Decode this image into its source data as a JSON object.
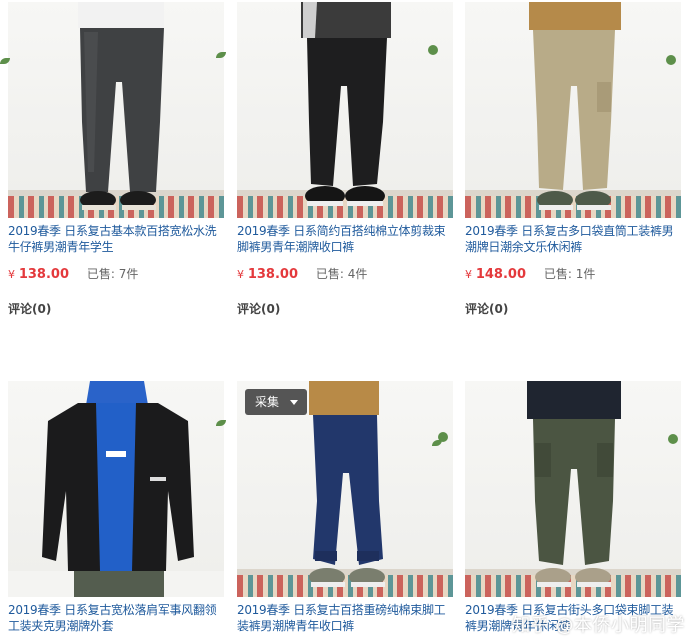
{
  "products": [
    {
      "title": "2019春季 日系复古基本款百搭宽松水洗牛仔裤男潮青年学生",
      "currency": "¥",
      "price": "138.00",
      "sold_label": "已售:",
      "sold": "7件",
      "comments": "评论(0)",
      "image": "dark-wash-jeans"
    },
    {
      "title": "2019春季 日系简约百搭纯棉立体剪裁束脚裤男青年潮牌收口裤",
      "currency": "¥",
      "price": "138.00",
      "sold_label": "已售:",
      "sold": "4件",
      "comments": "评论(0)",
      "image": "black-tapered-pants"
    },
    {
      "title": "2019春季 日系复古多口袋直筒工装裤男潮牌日潮余文乐休闲裤",
      "currency": "¥",
      "price": "148.00",
      "sold_label": "已售:",
      "sold": "1件",
      "comments": "评论(0)",
      "image": "khaki-cargo-pants"
    },
    {
      "title": "2019春季 日系复古宽松落肩军事风翻领工装夹克男潮牌外套",
      "image": "black-work-jacket"
    },
    {
      "title": "2019春季 日系复古百搭重磅纯棉束脚工装裤男潮牌青年收口裤",
      "image": "navy-jogger-pants"
    },
    {
      "title": "2019春季 日系复古街头多口袋束脚工装裤男潮牌青年休闲裤",
      "image": "olive-cargo-jogger"
    }
  ],
  "collect_button": "采集",
  "watermark": "知乎 @本侨小明同学",
  "colors": {
    "link": "#1f5a9c",
    "price": "#e4393c",
    "collect_bg": "#555555"
  }
}
